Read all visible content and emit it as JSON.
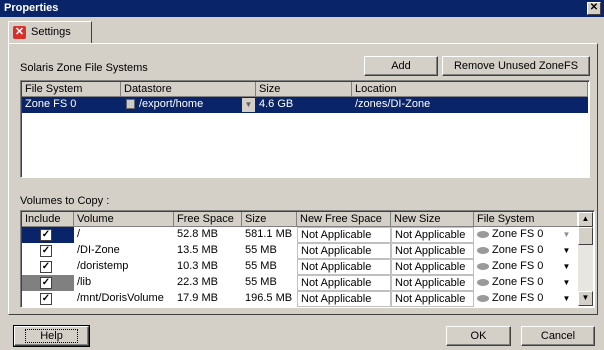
{
  "window": {
    "title": "Properties",
    "close_glyph": "✕"
  },
  "tab": {
    "label": "Settings",
    "icon": "settings-x-icon"
  },
  "zonefs": {
    "section_label": "Solaris Zone File Systems",
    "add_label": "Add",
    "remove_label": "Remove Unused ZoneFS",
    "columns": [
      "File System",
      "Datastore",
      "Size",
      "Location"
    ],
    "rows": [
      {
        "file_system": "Zone FS 0",
        "datastore": "/export/home",
        "size": "4.6 GB",
        "location": "/zones/DI-Zone"
      }
    ]
  },
  "volumes": {
    "section_label": "Volumes to Copy :",
    "columns": [
      "Include",
      "Volume",
      "Free Space",
      "Size",
      "New Free Space",
      "New Size",
      "File System"
    ],
    "rows": [
      {
        "include": true,
        "volume": "/",
        "free_space": "52.8 MB",
        "size": "581.1 MB",
        "new_free_space": "Not Applicable",
        "new_size": "Not Applicable",
        "file_system": "Zone FS 0"
      },
      {
        "include": true,
        "volume": "/DI-Zone",
        "free_space": "13.5 MB",
        "size": "55 MB",
        "new_free_space": "Not Applicable",
        "new_size": "Not Applicable",
        "file_system": "Zone FS 0"
      },
      {
        "include": true,
        "volume": "/doristemp",
        "free_space": "10.3 MB",
        "size": "55 MB",
        "new_free_space": "Not Applicable",
        "new_size": "Not Applicable",
        "file_system": "Zone FS 0"
      },
      {
        "include": true,
        "volume": "/lib",
        "free_space": "22.3 MB",
        "size": "55 MB",
        "new_free_space": "Not Applicable",
        "new_size": "Not Applicable",
        "file_system": "Zone FS 0"
      },
      {
        "include": true,
        "volume": "/mnt/DorisVolume",
        "free_space": "17.9 MB",
        "size": "196.5 MB",
        "new_free_space": "Not Applicable",
        "new_size": "Not Applicable",
        "file_system": "Zone FS 0"
      }
    ]
  },
  "footer": {
    "help_label": "Help",
    "ok_label": "OK",
    "cancel_label": "Cancel"
  },
  "colors": {
    "titlebar": "#0a246a",
    "selection": "#0a246a",
    "face": "#d4d0c8"
  }
}
